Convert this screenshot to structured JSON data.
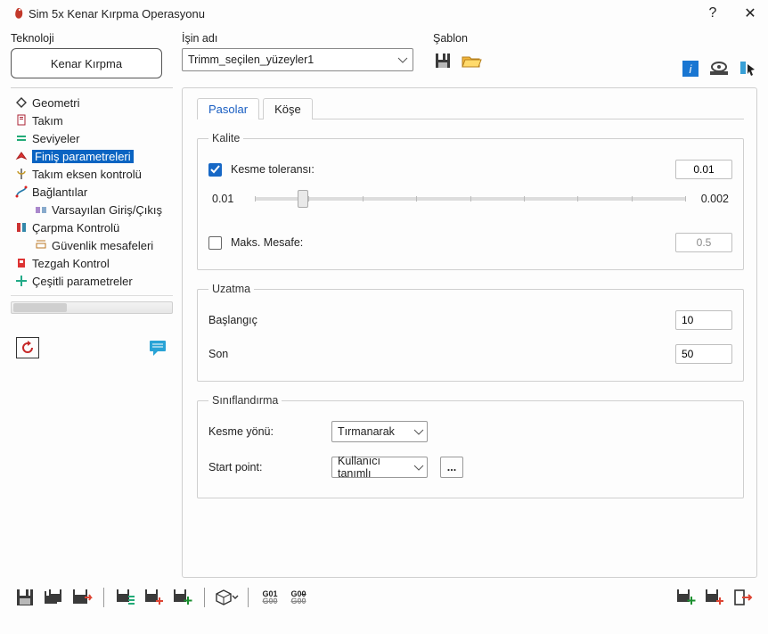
{
  "titlebar": {
    "title": "Sim 5x Kenar Kırpma Operasyonu",
    "help": "?",
    "close": "✕"
  },
  "top": {
    "tech_label": "Teknoloji",
    "tech_button": "Kenar Kırpma",
    "job_label": "İşin adı",
    "job_value": "Trimm_seçilen_yüzeyler1",
    "template_label": "Şablon"
  },
  "tree": {
    "items": [
      {
        "label": "Geometri"
      },
      {
        "label": "Takım"
      },
      {
        "label": "Seviyeler"
      },
      {
        "label": "Finiş parametreleri"
      },
      {
        "label": "Takım eksen kontrolü"
      },
      {
        "label": "Bağlantılar"
      },
      {
        "label": "Varsayılan Giriş/Çıkış"
      },
      {
        "label": "Çarpma Kontrolü"
      },
      {
        "label": "Güvenlik mesafeleri"
      },
      {
        "label": "Tezgah Kontrol"
      },
      {
        "label": "Çeşitli parametreler"
      }
    ]
  },
  "tabs": {
    "passes": "Pasolar",
    "corner": "Köşe"
  },
  "quality": {
    "legend": "Kalite",
    "cut_tol_label": "Kesme toleransı:",
    "cut_tol_value": "0.01",
    "slider_min": "0.01",
    "slider_max": "0.002",
    "max_dist_label": "Maks. Mesafe:",
    "max_dist_value": "0.5"
  },
  "extend": {
    "legend": "Uzatma",
    "start_label": "Başlangıç",
    "start_value": "10",
    "end_label": "Son",
    "end_value": "50"
  },
  "classification": {
    "legend": "Sınıflandırma",
    "cut_dir_label": "Kesme yönü:",
    "cut_dir_value": "Tırmanarak",
    "start_point_label": "Start point:",
    "start_point_value": "Kullanıcı tanımlı",
    "dots": "..."
  },
  "bottom": {
    "g01": "G01\nG00",
    "g00": "G00\nG00"
  }
}
